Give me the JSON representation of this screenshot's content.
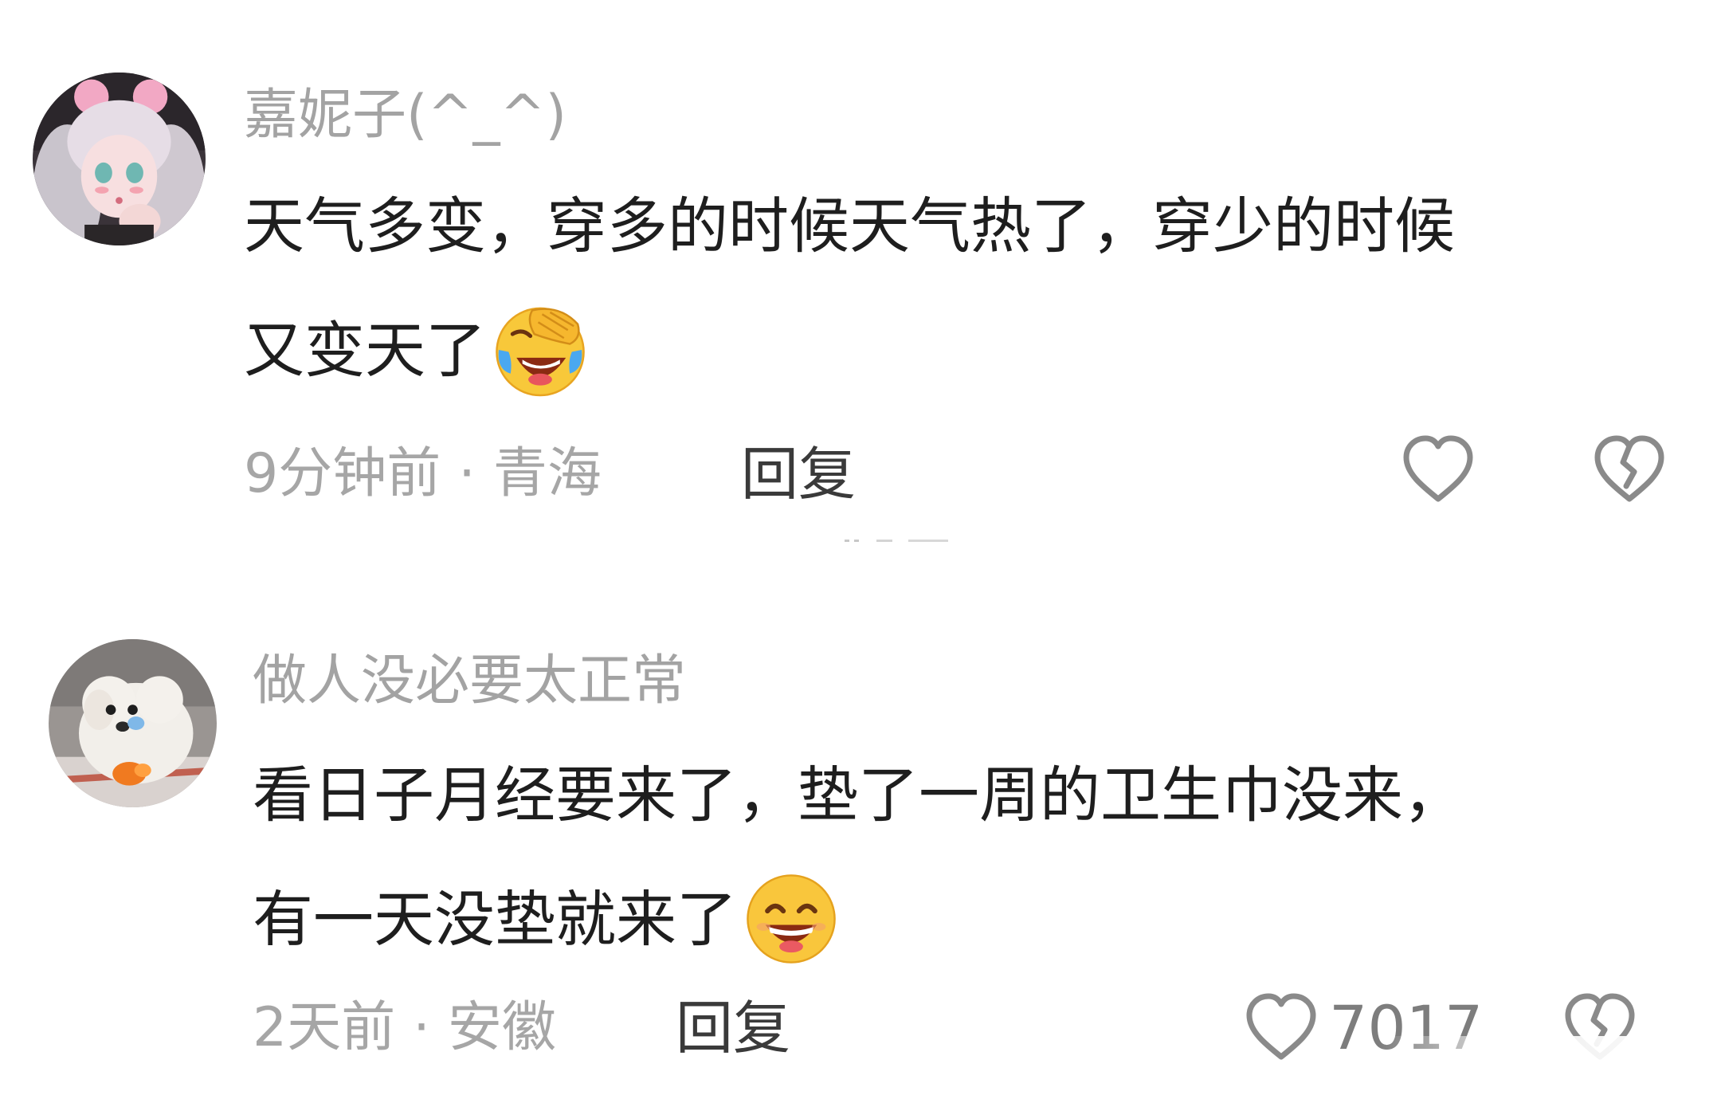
{
  "comments": [
    {
      "username": "嘉妮子(^_^)",
      "content_lines": [
        "天气多变，穿多的时候天气热了，穿少的时候",
        "又变天了"
      ],
      "emoji": "facepalm-crying-laugh-emoji",
      "time": "9分钟前",
      "separator": "·",
      "location": "青海",
      "reply_label": "回复",
      "like_icon": "heart-outline-icon",
      "dislike_icon": "broken-heart-icon"
    },
    {
      "username": "做人没必要太正常",
      "content_lines": [
        "看日子月经要来了，垫了一周的卫生巾没来，",
        "有一天没垫就来了"
      ],
      "emoji": "grinning-smiling-eyes-emoji",
      "time": "2天前",
      "separator": "·",
      "location": "安徽",
      "reply_label": "回复",
      "like_icon": "heart-outline-icon",
      "like_count": "7017",
      "dislike_icon": "broken-heart-icon"
    }
  ],
  "colors": {
    "username": "#a3a3a3",
    "content": "#1e1e1e",
    "meta": "#a6a6a6",
    "reply": "#3a3a3a",
    "icon": "#8a8a8a"
  }
}
